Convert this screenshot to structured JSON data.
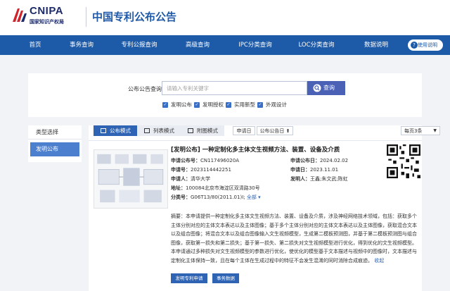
{
  "header": {
    "logo_text": "CNIPA",
    "logo_subtext": "国家知识产权局",
    "site_title": "中国专利公布公告"
  },
  "nav": {
    "items": [
      "首页",
      "事务查询",
      "专利公报查询",
      "高级查询",
      "IPC分类查询",
      "LOC分类查询",
      "数据说明"
    ],
    "help_label": "使用说明"
  },
  "search": {
    "label": "公布公告查询",
    "placeholder": "请输入专利关键字",
    "button_label": "查询",
    "filters": [
      "发明公布",
      "发明授权",
      "实用新型",
      "外观设计"
    ]
  },
  "sidebar": {
    "heading": "类型选择",
    "items": [
      "发明公布"
    ]
  },
  "toolbar": {
    "views": [
      "公布模式",
      "列表模式",
      "附图模式"
    ],
    "active_view": "公布模式",
    "sort_options": [
      "申请日",
      "公布公告日"
    ],
    "per_page": "每页3条"
  },
  "result": {
    "title": "[发明公布] 一种定制化多主体文生视频方法、装置、设备及介质",
    "fields": {
      "app_no_label": "申请公布号：",
      "app_no": "CN117496020A",
      "pub_date_label": "申请公布日：",
      "pub_date": "2024.02.02",
      "app_num_label": "申请号：",
      "app_num": "2023114442251",
      "app_date_label": "申请日：",
      "app_date": "2023.11.01",
      "applicant_label": "申请人：",
      "applicant": "清华大学",
      "inventor_label": "发明人：",
      "inventor": "王鑫;朱文武;陈虹",
      "address_label": "地址：",
      "address": "100084北京市海淀区双清路30号",
      "class_label": "分类号：",
      "class": "G06T13/80(2011.01)I;",
      "all_link": "全部"
    },
    "abstract": "摘要：本申请提供一种定制化多主体文生视频方法、装置、设备及介质，涉及神经网络技术领域，包括：获取多个主体分别对应的主体文本表达以及主体图像；基于多个主体分别对应的主体文本表达以及主体图像，获取混合文本以及组合图像；将混合文本以及组合图像输入文生视频模型，生成第二模板预测图，并基于第二模板预测图与组合图像，获取第一损失和第二损失；基于第一损失、第二损失对文生视频模型进行优化，得到优化的文生视频模型。本申请通过多种损失对文生视频模型的参数进行优化，使优化的模型基于文本描述与视频中的图像时，文本描述与定制化主体保持一致，且在每个主体在生成过程中的特征不会发生混淆的同时消除合成痕迹。",
    "more_link": "收起",
    "actions": [
      "发明专利申请",
      "事务数据"
    ]
  },
  "colors": {
    "nav_bg": "#1d5aa7",
    "accent": "#2f64b4",
    "search_button": "#4a61b5"
  }
}
